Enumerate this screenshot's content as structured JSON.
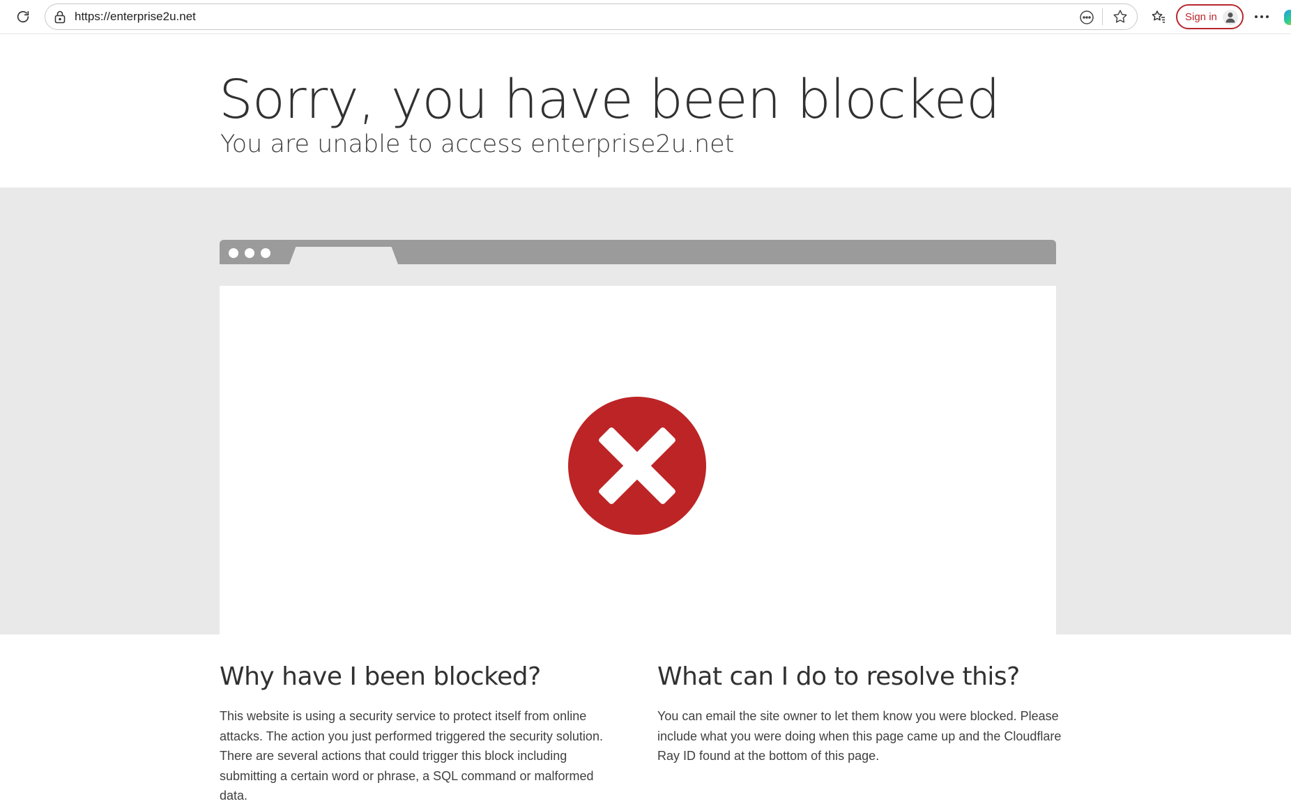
{
  "browser": {
    "url": "https://enterprise2u.net",
    "sign_in_label": "Sign in",
    "icons": {
      "refresh": "refresh-icon",
      "lock": "lock-icon",
      "reader": "reader-mode-icon",
      "favorite": "star-icon",
      "favorites": "favorites-list-icon",
      "profile": "profile-icon",
      "more": "more-icon"
    },
    "accent_color": "#b8262b"
  },
  "header": {
    "title": "Sorry, you have been blocked",
    "subtitle": "You are unable to access enterprise2u.net"
  },
  "illustration": {
    "icon": "error-x-icon",
    "icon_color": "#bd2426"
  },
  "why_section": {
    "title": "Why have I been blocked?",
    "body": "This website is using a security service to protect itself from online attacks. The action you just performed triggered the security solution. There are several actions that could trigger this block including submitting a certain word or phrase, a SQL command or malformed data."
  },
  "resolve_section": {
    "title": "What can I do to resolve this?",
    "body": "You can email the site owner to let them know you were blocked. Please include what you were doing when this page came up and the Cloudflare Ray ID found at the bottom of this page."
  }
}
